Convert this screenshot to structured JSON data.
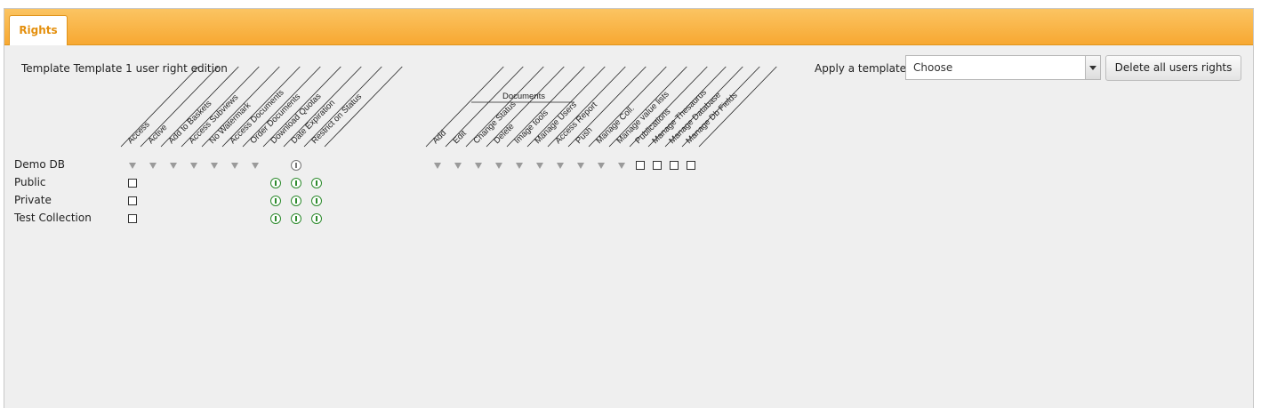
{
  "tabs": [
    {
      "label": "Rights"
    }
  ],
  "title": "Template Template 1 user right edition",
  "apply_template_label": "Apply a template",
  "template_select": {
    "value": "Choose"
  },
  "delete_button": "Delete all users rights",
  "group1_columns": [
    "Access",
    "Active",
    "Add to Baskets",
    "Access Subviews",
    "No Watermark",
    "Access Documents",
    "Order Documents",
    "Download Quotas",
    "Date Expiration",
    "Restrict on Status"
  ],
  "documents_group_label": "Documents",
  "group2_columns": [
    "Add",
    "Edit",
    "Change Status",
    "Delete",
    "Image tools",
    "Manage Users",
    "Access Report",
    "Push",
    "Manage Coll.",
    "Manage value lists",
    "Publications",
    "Manage Thesaurus",
    "Manage Database",
    "Manage Db Fields"
  ],
  "rows": [
    {
      "label": "Demo DB"
    },
    {
      "label": "Public"
    },
    {
      "label": "Private"
    },
    {
      "label": "Test Collection"
    }
  ]
}
